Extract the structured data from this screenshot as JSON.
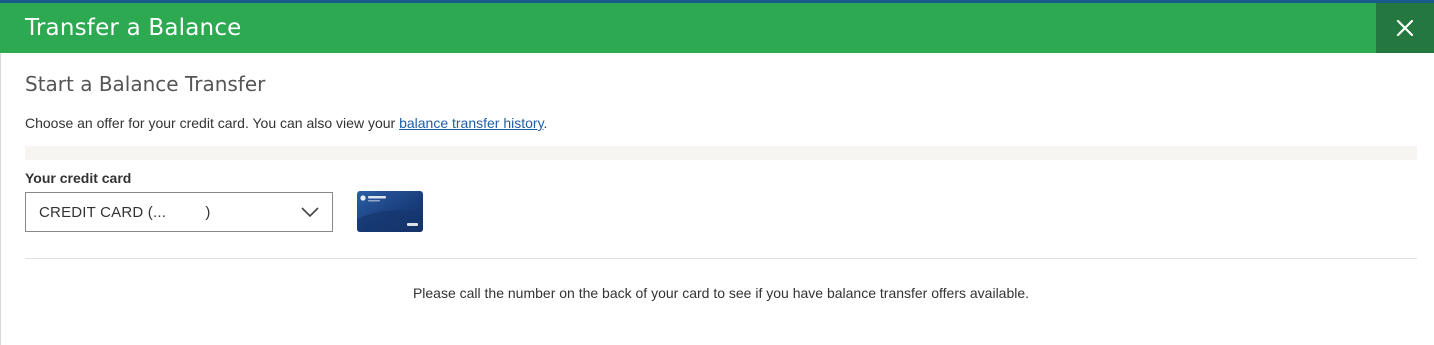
{
  "header": {
    "title": "Transfer a Balance",
    "close_icon": "close-icon",
    "accent_color": "#2ca951",
    "close_bg_color": "#24773f"
  },
  "main": {
    "subtitle": "Start a Balance Transfer",
    "intro_text": "Choose an offer for your credit card. You can also view your ",
    "history_link": "balance transfer history",
    "intro_end": ".",
    "card_field": {
      "label": "Your credit card",
      "selected_value": "CREDIT CARD (...         )",
      "icon": "chevron-down-icon"
    },
    "card_image_icon": "credit-card-image",
    "notice": "Please call the number on the back of your card to see if you have balance transfer offers available."
  }
}
